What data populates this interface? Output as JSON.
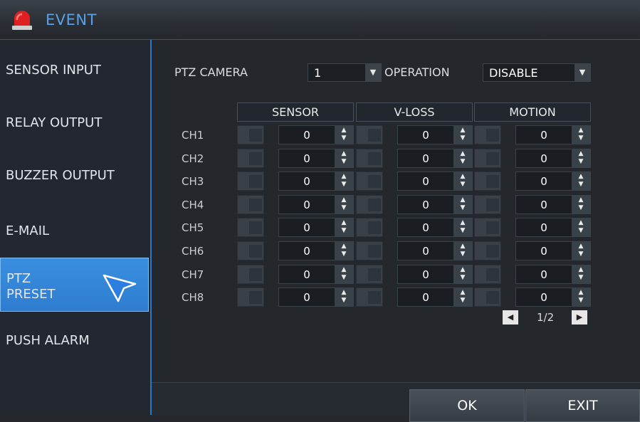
{
  "window": {
    "title": "EVENT",
    "icon": "alarm-light-icon"
  },
  "sidebar": {
    "items": [
      {
        "label": "SENSOR INPUT"
      },
      {
        "label": "RELAY OUTPUT"
      },
      {
        "label": "BUZZER OUTPUT"
      },
      {
        "label": "E-MAIL"
      },
      {
        "label": "PTZ\nPRESET",
        "active": true
      },
      {
        "label": "PUSH ALARM"
      }
    ]
  },
  "form": {
    "ptz_camera_label": "PTZ CAMERA",
    "ptz_camera_value": "1",
    "operation_label": "OPERATION",
    "operation_value": "DISABLE"
  },
  "table": {
    "columns": [
      "SENSOR",
      "V-LOSS",
      "MOTION"
    ],
    "rows": [
      {
        "ch": "CH1",
        "sensor": "0",
        "vloss": "0",
        "motion": "0"
      },
      {
        "ch": "CH2",
        "sensor": "0",
        "vloss": "0",
        "motion": "0"
      },
      {
        "ch": "CH3",
        "sensor": "0",
        "vloss": "0",
        "motion": "0"
      },
      {
        "ch": "CH4",
        "sensor": "0",
        "vloss": "0",
        "motion": "0"
      },
      {
        "ch": "CH5",
        "sensor": "0",
        "vloss": "0",
        "motion": "0"
      },
      {
        "ch": "CH6",
        "sensor": "0",
        "vloss": "0",
        "motion": "0"
      },
      {
        "ch": "CH7",
        "sensor": "0",
        "vloss": "0",
        "motion": "0"
      },
      {
        "ch": "CH8",
        "sensor": "0",
        "vloss": "0",
        "motion": "0"
      }
    ]
  },
  "pager": {
    "text": "1/2"
  },
  "buttons": {
    "ok": "OK",
    "exit": "EXIT"
  },
  "colors": {
    "accent": "#2e7cd0",
    "title": "#5aa0e6",
    "alarm": "#e02020"
  }
}
